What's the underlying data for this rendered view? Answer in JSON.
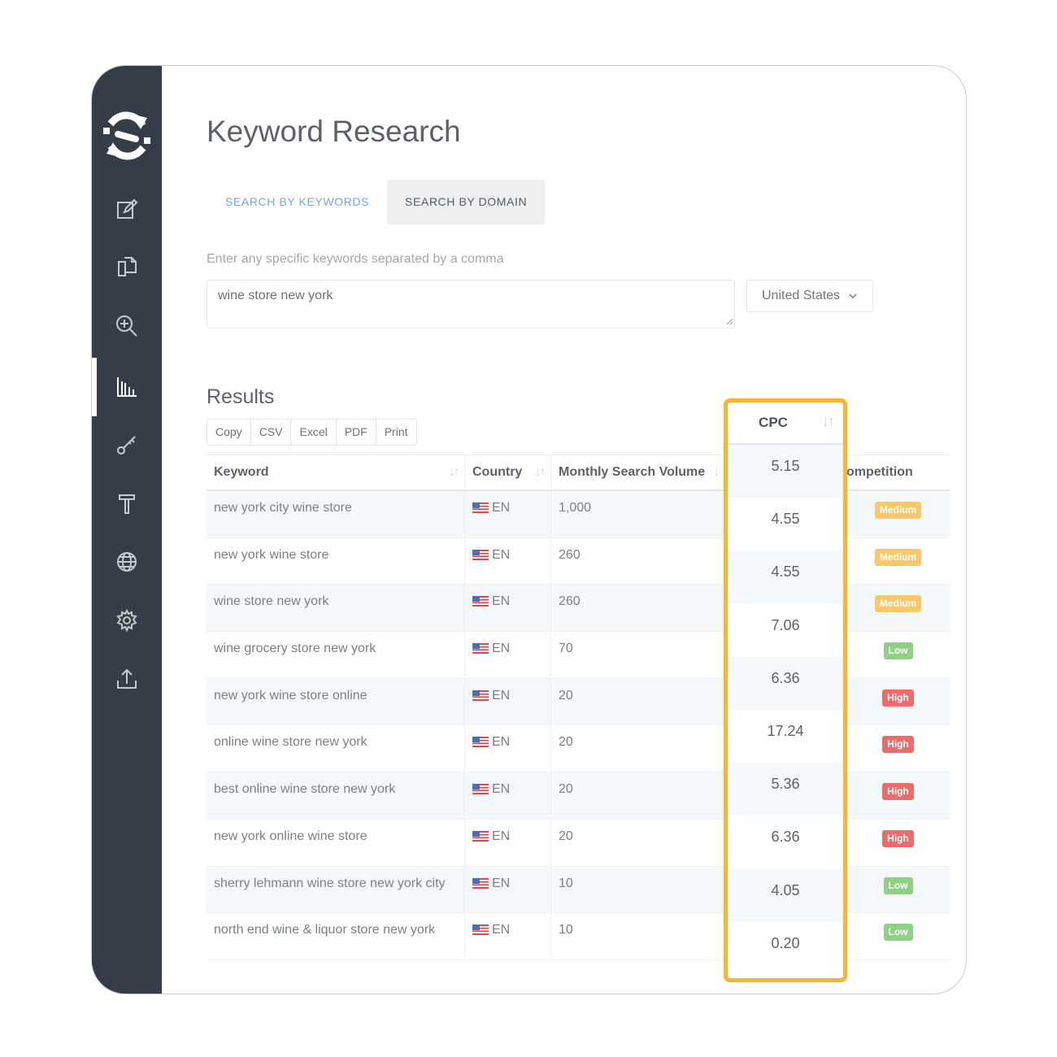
{
  "page": {
    "title": "Keyword Research"
  },
  "tabs": [
    {
      "label": "SEARCH BY KEYWORDS",
      "active": true
    },
    {
      "label": "SEARCH BY DOMAIN",
      "active": false
    }
  ],
  "search": {
    "hint": "Enter any specific keywords separated by a comma",
    "value": "wine store new york",
    "country": "United States"
  },
  "results": {
    "title": "Results",
    "export_buttons": [
      "Copy",
      "CSV",
      "Excel",
      "PDF",
      "Print"
    ],
    "columns": {
      "keyword": "Keyword",
      "country": "Country",
      "volume": "Monthly Search Volume",
      "cpc": "CPC",
      "competition": "ompetition"
    },
    "rows": [
      {
        "keyword": "new york city wine store",
        "lang": "EN",
        "volume": "1,000",
        "cpc": "5.15",
        "competition": "Medium"
      },
      {
        "keyword": "new york wine store",
        "lang": "EN",
        "volume": "260",
        "cpc": "4.55",
        "competition": "Medium"
      },
      {
        "keyword": "wine store new york",
        "lang": "EN",
        "volume": "260",
        "cpc": "4.55",
        "competition": "Medium"
      },
      {
        "keyword": "wine grocery store new york",
        "lang": "EN",
        "volume": "70",
        "cpc": "7.06",
        "competition": "Low"
      },
      {
        "keyword": "new york wine store online",
        "lang": "EN",
        "volume": "20",
        "cpc": "6.36",
        "competition": "High"
      },
      {
        "keyword": "online wine store new york",
        "lang": "EN",
        "volume": "20",
        "cpc": "17.24",
        "competition": "High"
      },
      {
        "keyword": "best online wine store new york",
        "lang": "EN",
        "volume": "20",
        "cpc": "5.36",
        "competition": "High"
      },
      {
        "keyword": "new york online wine store",
        "lang": "EN",
        "volume": "20",
        "cpc": "6.36",
        "competition": "High"
      },
      {
        "keyword": "sherry lehmann wine store new york city",
        "lang": "EN",
        "volume": "10",
        "cpc": "4.05",
        "competition": "Low"
      },
      {
        "keyword": "north end wine & liquor store new york",
        "lang": "EN",
        "volume": "10",
        "cpc": "0.20",
        "competition": "Low"
      }
    ]
  },
  "colors": {
    "sidebar": "#353e48",
    "highlight": "#f8b436",
    "active_tab": "#7aa6dd",
    "competition": {
      "Medium": "#f8c86a",
      "Low": "#8fcf86",
      "High": "#ef6a6a"
    }
  },
  "sidebar_icons": [
    "edit-icon",
    "copy-docs-icon",
    "zoom-in-icon",
    "bar-chart-icon",
    "key-icon",
    "hammer-icon",
    "globe-icon",
    "gear-icon",
    "upload-icon"
  ]
}
